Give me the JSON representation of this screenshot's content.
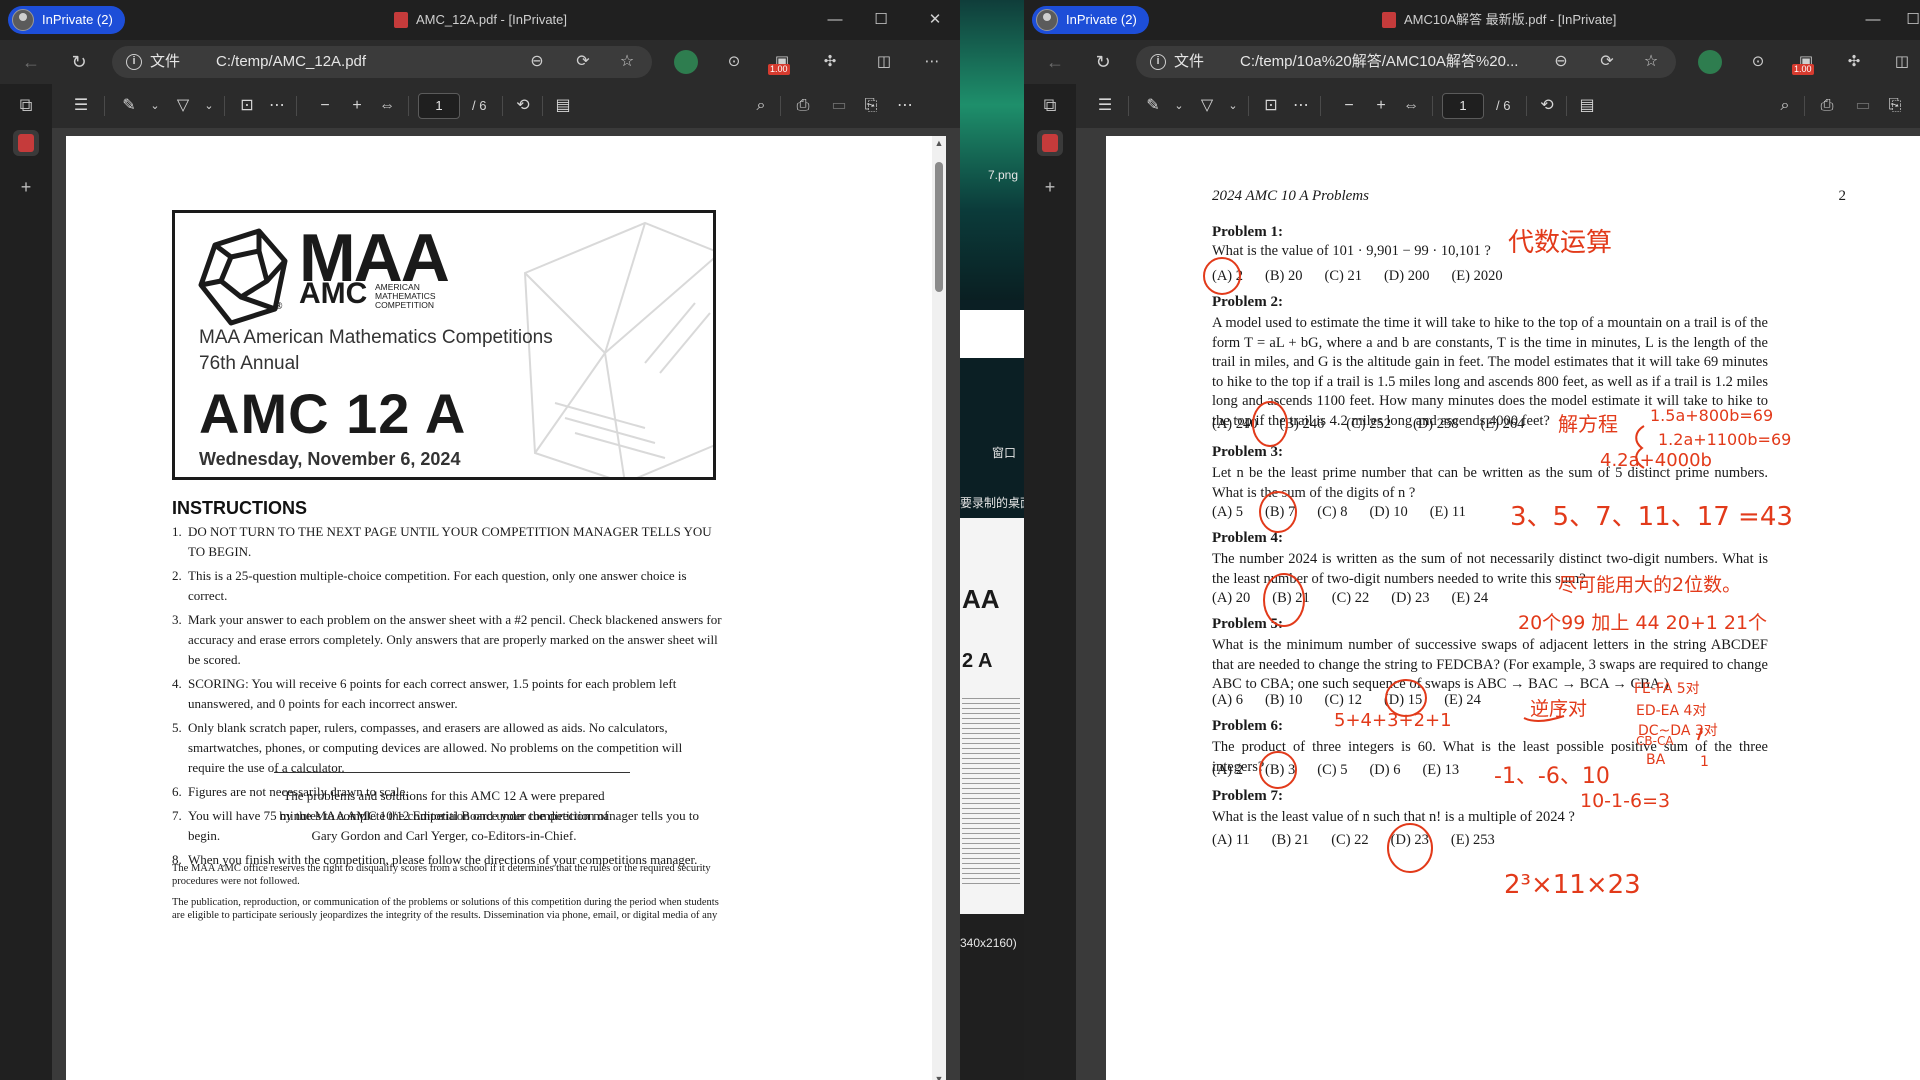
{
  "left_window": {
    "inprivate_label": "InPrivate (2)",
    "tab_title": "AMC_12A.pdf - [InPrivate]",
    "url_scheme": "文件",
    "url_path": "C:/temp/AMC_12A.pdf",
    "ext_badge": "1.00",
    "toolbar": {
      "page_current": "1",
      "page_total": "/ 6"
    },
    "document": {
      "org_logo_big": "MAA",
      "org_logo_small": "AMC",
      "org_logo_sub": "AMERICAN MATHEMATICS COMPETITION",
      "competitions_line": "MAA American Mathematics Competitions",
      "annual_line": "76th Annual",
      "title": "AMC 12 A",
      "date": "Wednesday, November 6, 2024",
      "instructions_heading": "INSTRUCTIONS",
      "instructions": [
        "DO NOT TURN TO THE NEXT PAGE UNTIL YOUR COMPETITION MANAGER TELLS YOU TO BEGIN.",
        "This is a 25-question multiple-choice competition. For each question, only one answer choice is correct.",
        "Mark your answer to each problem on the answer sheet with a #2 pencil. Check blackened answers for accuracy and erase errors completely. Only answers that are properly marked on the answer sheet will be scored.",
        "SCORING: You will receive 6 points for each correct answer, 1.5 points for each problem left unanswered, and 0 points for each incorrect answer.",
        "Only blank scratch paper, rulers, compasses, and erasers are allowed as aids. No calculators, smartwatches, phones, or computing devices are allowed. No problems on the competition will require the use of a calculator.",
        "Figures are not necessarily drawn to scale.",
        "You will have 75 minutes to complete the competition once your competition manager tells you to begin.",
        "When you finish with the competition, please follow the directions of your competitions manager."
      ],
      "prepared_lines": [
        "The problems and solutions for this AMC 12 A were prepared",
        "by the MAA AMC 10/12 Editorial Board under the direction of",
        "Gary Gordon and Carl Yerger, co-Editors-in-Chief."
      ],
      "fine_print_1": "The MAA AMC office reserves the right to disqualify scores from a school if it determines that the rules or the required security procedures were not followed.",
      "fine_print_2": "The publication, reproduction, or communication of the problems or solutions of this competition during the period when students are eligible to participate seriously jeopardizes the integrity of the results. Dissemination via phone, email, or digital media of any"
    }
  },
  "middle_strip": {
    "file_label": "7.png",
    "window_label": "窗口",
    "record_label": "要录制的桌面",
    "thumb_logo": "AA",
    "thumb_title": "2 A",
    "resolution_label": "340x2160)"
  },
  "right_window": {
    "inprivate_label": "InPrivate (2)",
    "tab_title": "AMC10A解答 最新版.pdf - [InPrivate]",
    "url_scheme": "文件",
    "url_path": "C:/temp/10a%20解答/AMC10A解答%20...",
    "ext_badge": "1.00",
    "toolbar": {
      "page_current": "1",
      "page_total": "/ 6"
    },
    "document": {
      "header": "2024 AMC 10 A Problems",
      "page_number": "2",
      "problems": [
        {
          "title": "Problem 1:",
          "text": "What is the value of 101 · 9,901 − 99 · 10,101 ?",
          "choices": [
            "(A) 2",
            "(B) 20",
            "(C) 21",
            "(D) 200",
            "(E) 2020"
          ]
        },
        {
          "title": "Problem 2:",
          "text": "A model used to estimate the time it will take to hike to the top of a mountain on a trail is of the form T = aL + bG, where a and b are constants, T is the time in minutes, L is the length of the trail in miles, and G is the altitude gain in feet. The model estimates that it will take 69 minutes to hike to the top if a trail is 1.5 miles long and ascends 800 feet, as well as if a trail is 1.2 miles long and ascends 1100 feet. How many minutes does the model estimate it will take to hike to the top if the trail is 4.2 miles long and ascends 4000 feet?",
          "choices": [
            "(A) 240",
            "(B) 246",
            "(C) 252",
            "(D) 258",
            "(E) 264"
          ]
        },
        {
          "title": "Problem 3:",
          "text": "Let n be the least prime number that can be written as the sum of 5 distinct prime numbers. What is the sum of the digits of n ?",
          "choices": [
            "(A) 5",
            "(B) 7",
            "(C) 8",
            "(D) 10",
            "(E) 11"
          ]
        },
        {
          "title": "Problem 4:",
          "text": "The number 2024 is written as the sum of not necessarily distinct two-digit numbers. What is the least number of two-digit numbers needed to write this sum?",
          "choices": [
            "(A) 20",
            "(B) 21",
            "(C) 22",
            "(D) 23",
            "(E) 24"
          ]
        },
        {
          "title": "Problem 5:",
          "text": "What is the minimum number of successive swaps of adjacent letters in the string ABCDEF that are needed to change the string to FEDCBA? (For example, 3 swaps are required to change ABC to CBA; one such sequence of swaps is ABC → BAC → BCA → CBA.)",
          "choices": [
            "(A) 6",
            "(B) 10",
            "(C) 12",
            "(D) 15",
            "(E) 24"
          ]
        },
        {
          "title": "Problem 6:",
          "text": "The product of three integers is 60. What is the least possible positive sum of the three integers?",
          "choices": [
            "(A) 2",
            "(B) 3",
            "(C) 5",
            "(D) 6",
            "(E) 13"
          ]
        },
        {
          "title": "Problem 7:",
          "text": "What is the least value of n such that n! is a multiple of 2024 ?",
          "choices": [
            "(A) 11",
            "(B) 21",
            "(C) 22",
            "(D) 23",
            "(E) 253"
          ]
        }
      ],
      "annotations": {
        "p1_note": "代数运算",
        "p2_note": "解方程",
        "p2_eq1": "1.5a+800b=69",
        "p2_eq2": "1.2a+1100b=69",
        "p2_eq3": "4.2a+4000b",
        "p3_note": "3、5、7、11、17 =43",
        "p4_note": "尽可能用大的2位数。",
        "p4_work": "20个99 加上 44    20+1  21个",
        "p5_fe": "FE-FA 5对",
        "p5_ed": "ED-EA 4对",
        "p5_dc": "DC~DA 3对",
        "p5_cb": "CB-CA",
        "p5_ba": "BA",
        "p5_one": "1",
        "p5_note": "逆序对",
        "p5_sum": "5+4+3+2+1",
        "p6_note": "-1、-6、10",
        "p6_calc": "10-1-6=3",
        "p7_note": "2³×11×23"
      }
    }
  }
}
